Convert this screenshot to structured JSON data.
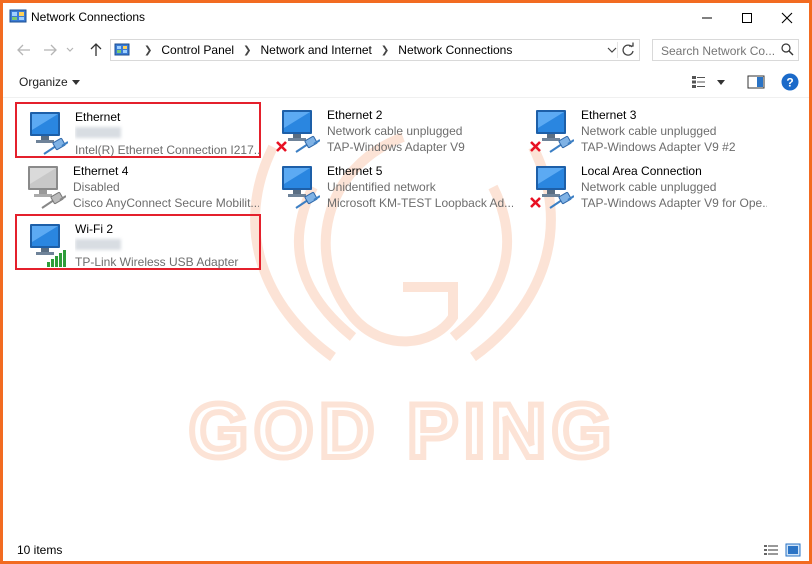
{
  "window": {
    "title": "Network Connections",
    "border_color": "#f26b21"
  },
  "nav": {
    "breadcrumbs": [
      "Control Panel",
      "Network and Internet",
      "Network Connections"
    ],
    "search_placeholder": "Search Network Co..."
  },
  "command_bar": {
    "organize_label": "Organize"
  },
  "watermark": {
    "text": "GOD PING",
    "color": "#f26b21"
  },
  "connections": [
    {
      "name": "Ethernet",
      "status": "",
      "adapter": "Intel(R) Ethernet Connection I217...",
      "type": "ethernet",
      "state": "connected",
      "selected": true
    },
    {
      "name": "Ethernet 2",
      "status": "Network cable unplugged",
      "adapter": "TAP-Windows Adapter V9",
      "type": "ethernet",
      "state": "unplugged",
      "selected": false
    },
    {
      "name": "Ethernet 3",
      "status": "Network cable unplugged",
      "adapter": "TAP-Windows Adapter V9 #2",
      "type": "ethernet",
      "state": "unplugged",
      "selected": false
    },
    {
      "name": "Ethernet 4",
      "status": "Disabled",
      "adapter": "Cisco AnyConnect Secure Mobilit...",
      "type": "ethernet",
      "state": "disabled",
      "selected": false
    },
    {
      "name": "Ethernet 5",
      "status": "Unidentified network",
      "adapter": "Microsoft KM-TEST Loopback Ad...",
      "type": "ethernet",
      "state": "connected",
      "selected": false
    },
    {
      "name": "Local Area Connection",
      "status": "Network cable unplugged",
      "adapter": "TAP-Windows Adapter V9 for Ope...",
      "type": "ethernet",
      "state": "unplugged",
      "selected": false
    },
    {
      "name": "Wi-Fi 2",
      "status": "",
      "adapter": "TP-Link Wireless USB Adapter",
      "type": "wifi",
      "state": "connected",
      "selected": true
    }
  ],
  "status_bar": {
    "item_count": "10 items"
  },
  "colors": {
    "selection_border": "#e4202c",
    "secondary_text": "#6d6d6d",
    "unplugged_x": "#e81123",
    "wifi_signal": "#2e9d3a"
  }
}
